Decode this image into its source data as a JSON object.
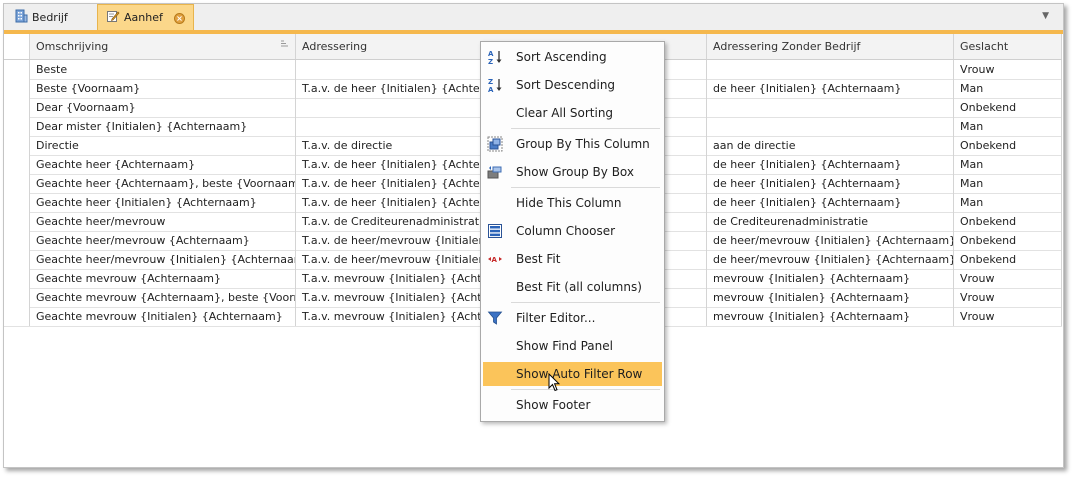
{
  "tabs": [
    {
      "label": "Bedrijf",
      "icon": "building-icon",
      "active": false
    },
    {
      "label": "Aanhef",
      "icon": "edit-document-icon",
      "active": true
    }
  ],
  "colors": {
    "accent": "#f5b84d",
    "active_tab": "#fbd78a",
    "menu_highlight": "#fbc45a"
  },
  "grid": {
    "columns": [
      "Omschrijving",
      "Adressering",
      "Adressering Zonder Bedrijf",
      "Geslacht"
    ],
    "rows": [
      [
        "Beste",
        "",
        "",
        "Vrouw"
      ],
      [
        "Beste {Voornaam}",
        "T.a.v. de heer {Initialen} {Achterna",
        "de heer {Initialen} {Achternaam}",
        "Man"
      ],
      [
        "Dear {Voornaam}",
        "",
        "",
        "Onbekend"
      ],
      [
        "Dear mister  {Initialen} {Achternaam}",
        "",
        "",
        "Man"
      ],
      [
        "Directie",
        "T.a.v. de directie",
        "aan de directie",
        "Onbekend"
      ],
      [
        "Geachte heer {Achternaam}",
        "T.a.v. de heer {Initialen} {Achterna",
        "de heer {Initialen} {Achternaam}",
        "Man"
      ],
      [
        "Geachte heer {Achternaam}, beste {Voornaam}",
        "T.a.v. de heer {Initialen} {Achterna",
        "de heer {Initialen} {Achternaam}",
        "Man"
      ],
      [
        "Geachte heer {Initialen} {Achternaam}",
        "T.a.v. de heer {Initialen} {Achterna",
        "de heer {Initialen} {Achternaam}",
        "Man"
      ],
      [
        "Geachte heer/mevrouw",
        "T.a.v. de Crediteurenadministratie",
        "de Crediteurenadministratie",
        "Onbekend"
      ],
      [
        "Geachte heer/mevrouw {Achternaam}",
        "T.a.v. de heer/mevrouw {Initialen} {",
        "de heer/mevrouw {Initialen} {Achternaam}",
        "Onbekend"
      ],
      [
        "Geachte heer/mevrouw {Initialen} {Achternaam}",
        "T.a.v. de heer/mevrouw {Initialen} {",
        "de heer/mevrouw {Initialen} {Achternaam}",
        "Onbekend"
      ],
      [
        "Geachte mevrouw {Achternaam}",
        "T.a.v. mevrouw {Initialen} {Achterna",
        "mevrouw {Initialen} {Achternaam}",
        "Vrouw"
      ],
      [
        "Geachte mevrouw {Achternaam}, beste {Voornaam}",
        "T.a.v. mevrouw {Initialen} {Achterna",
        "mevrouw {Initialen} {Achternaam}",
        "Vrouw"
      ],
      [
        "Geachte mevrouw {Initialen} {Achternaam}",
        "T.a.v. mevrouw {Initialen} {Achterna",
        "mevrouw {Initialen} {Achternaam}",
        "Vrouw"
      ]
    ]
  },
  "context_menu": {
    "items": [
      {
        "label": "Sort Ascending",
        "icon": "sort-ascending-icon"
      },
      {
        "label": "Sort Descending",
        "icon": "sort-descending-icon"
      },
      {
        "label": "Clear All Sorting",
        "icon": ""
      },
      {
        "label": "Group By This Column",
        "icon": "group-by-column-icon"
      },
      {
        "label": "Show Group By Box",
        "icon": "group-by-box-icon"
      },
      {
        "label": "Hide This Column",
        "icon": ""
      },
      {
        "label": "Column Chooser",
        "icon": "column-chooser-icon"
      },
      {
        "label": "Best Fit",
        "icon": "best-fit-icon"
      },
      {
        "label": "Best Fit (all columns)",
        "icon": ""
      },
      {
        "label": "Filter Editor...",
        "icon": "filter-icon"
      },
      {
        "label": "Show Find Panel",
        "icon": ""
      },
      {
        "label": "Show Auto Filter Row",
        "icon": "",
        "highlighted": true
      },
      {
        "label": "Show Footer",
        "icon": ""
      }
    ]
  }
}
